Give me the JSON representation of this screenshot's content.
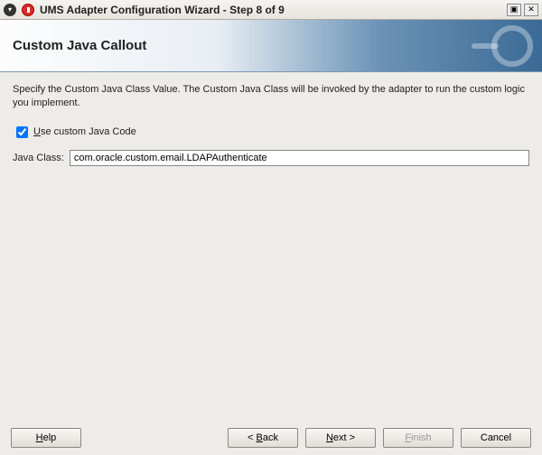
{
  "titlebar": {
    "text": "UMS Adapter Configuration Wizard - Step 8 of 9"
  },
  "banner": {
    "heading": "Custom Java Callout"
  },
  "main": {
    "description": "Specify the Custom Java Class Value. The Custom Java Class will be invoked by the adapter to run the custom logic you implement.",
    "checkbox_label_pre": "",
    "checkbox_mnemonic": "U",
    "checkbox_label_post": "se custom Java Code",
    "checkbox_checked": true,
    "java_class_label": "Java Class:",
    "java_class_value": "com.oracle.custom.email.LDAPAuthenticate"
  },
  "buttons": {
    "help_mn": "H",
    "help_post": "elp",
    "back_pre": "< ",
    "back_mn": "B",
    "back_post": "ack",
    "next_mn": "N",
    "next_post": "ext >",
    "finish_mn": "F",
    "finish_post": "inish",
    "cancel": "Cancel",
    "finish_enabled": false
  }
}
